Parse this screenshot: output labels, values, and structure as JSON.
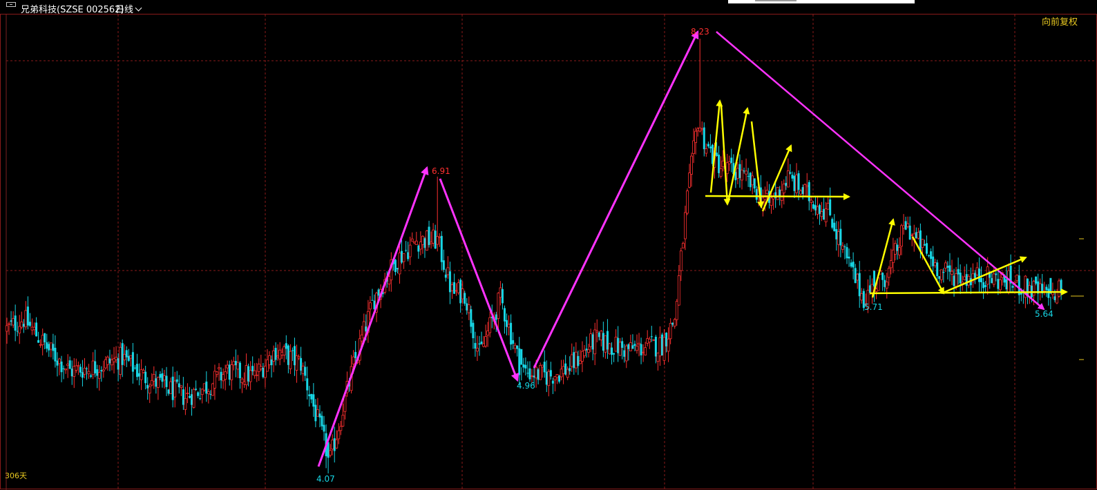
{
  "header": {
    "stock_name": "兄弟科技(SZSE 002562)",
    "period": "日线",
    "adjustment": "向前复权"
  },
  "footer": {
    "days_label": "306天"
  },
  "colors": {
    "up": "#ff3030",
    "down": "#17d7e6",
    "grid": "#8b1a1a",
    "magenta": "#ff33ff",
    "yellow": "#ffff00",
    "label_yellow": "#e8c820"
  },
  "chart_data": {
    "type": "candlestick",
    "title": "",
    "visible_days": 306,
    "ylim": [
      3.9,
      8.45
    ],
    "key_points": [
      {
        "label": "4.07",
        "price": 4.07,
        "day": 153,
        "kind": "low"
      },
      {
        "label": "6.91",
        "price": 6.91,
        "day": 205,
        "kind": "high"
      },
      {
        "label": "4.96",
        "price": 4.96,
        "day": 245,
        "kind": "low"
      },
      {
        "label": "8.23",
        "price": 8.23,
        "day": 330,
        "kind": "high"
      },
      {
        "label": "5.71",
        "price": 5.71,
        "day": 413,
        "kind": "low"
      },
      {
        "label": "5.64",
        "price": 5.64,
        "day": 497,
        "kind": "low"
      }
    ],
    "close_path": [
      [
        0,
        5.45
      ],
      [
        8,
        5.55
      ],
      [
        20,
        5.25
      ],
      [
        30,
        5.05
      ],
      [
        45,
        5.1
      ],
      [
        55,
        5.18
      ],
      [
        65,
        5.0
      ],
      [
        85,
        4.8
      ],
      [
        95,
        4.9
      ],
      [
        105,
        5.05
      ],
      [
        118,
        5.0
      ],
      [
        128,
        5.25
      ],
      [
        140,
        5.12
      ],
      [
        152,
        4.3
      ],
      [
        153,
        4.12
      ],
      [
        165,
        5.1
      ],
      [
        175,
        5.75
      ],
      [
        185,
        6.1
      ],
      [
        195,
        6.3
      ],
      [
        205,
        6.3
      ],
      [
        212,
        5.8
      ],
      [
        218,
        5.8
      ],
      [
        225,
        5.2
      ],
      [
        235,
        5.75
      ],
      [
        245,
        5.05
      ],
      [
        258,
        5.0
      ],
      [
        268,
        5.08
      ],
      [
        280,
        5.35
      ],
      [
        295,
        5.25
      ],
      [
        312,
        5.3
      ],
      [
        318,
        5.55
      ],
      [
        324,
        6.7
      ],
      [
        329,
        7.45
      ],
      [
        333,
        7.2
      ],
      [
        340,
        7.0
      ],
      [
        348,
        6.95
      ],
      [
        356,
        6.8
      ],
      [
        363,
        6.65
      ],
      [
        372,
        6.9
      ],
      [
        380,
        6.75
      ],
      [
        392,
        6.55
      ],
      [
        400,
        6.1
      ],
      [
        408,
        5.75
      ],
      [
        413,
        5.85
      ],
      [
        420,
        6.0
      ],
      [
        428,
        6.45
      ],
      [
        435,
        6.25
      ],
      [
        445,
        6.0
      ],
      [
        455,
        5.95
      ],
      [
        465,
        5.95
      ],
      [
        478,
        5.9
      ],
      [
        492,
        5.8
      ],
      [
        497,
        5.72
      ],
      [
        502,
        5.85
      ]
    ]
  }
}
